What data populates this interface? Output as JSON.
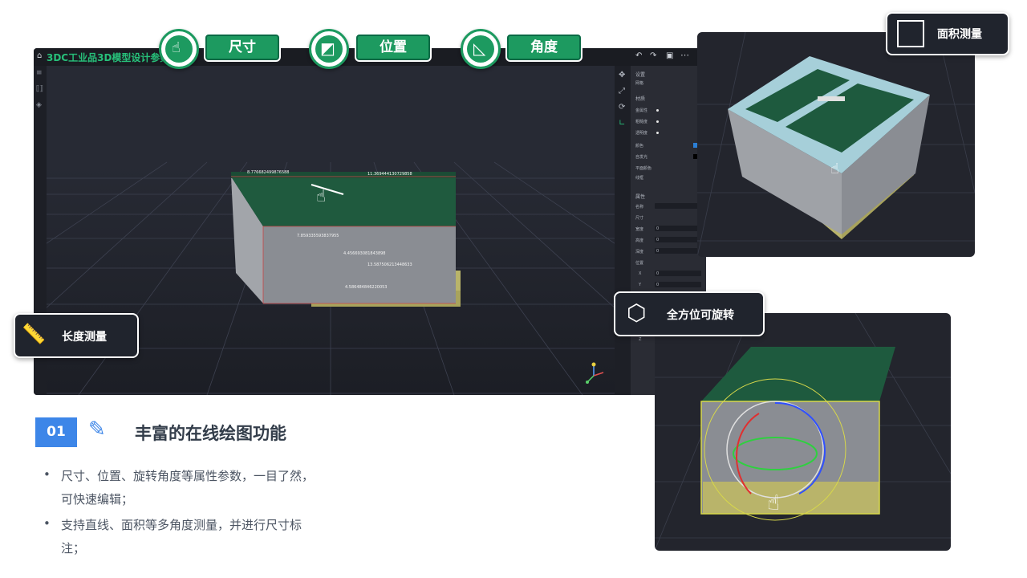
{
  "editor": {
    "title": "3DC工业品3D模型设计参数",
    "measurements": [
      "8.776682499876588",
      "11.369444130729858",
      "7.859335593837955",
      "4.456693081843898",
      "13.587506213448633",
      "4.586484846220053"
    ],
    "panel": {
      "section_settings": "设置",
      "settings_sub": "网格",
      "section_material": "材质",
      "rows_material": [
        "金属性",
        "粗糙度",
        "透明度",
        "颜色",
        "自发光",
        "平面颜色",
        "线框"
      ],
      "section_props": "属性",
      "rows_props": [
        "名称",
        "尺寸",
        "宽度",
        "高度",
        "深度",
        "位置",
        "X",
        "Y",
        "Z"
      ],
      "zero": "0"
    }
  },
  "tools": {
    "size_label": "尺寸",
    "position_label": "位置",
    "angle_label": "角度"
  },
  "badges": {
    "area": "面积测量",
    "length": "长度测量",
    "rotate": "全方位可旋转"
  },
  "section": {
    "number": "01",
    "title": "丰富的在线绘图功能",
    "bullets": [
      [
        "尺寸、位置、旋转角度等属性参数，一目了然，",
        "可快速编辑；"
      ],
      [
        "支持直线、面积等多角度测量，并进行尺寸标",
        "注；"
      ]
    ]
  },
  "colors": {
    "accent_green": "#1d9a60",
    "accent_blue": "#3d86e8",
    "badge_dark": "#20242d",
    "app_title_green": "#27c07a"
  },
  "icons": [
    "home-icon",
    "hand-cursor-icon",
    "move-icon",
    "rotate-icon",
    "angle-icon",
    "area-icon",
    "ruler-icon",
    "cube-rotate-icon",
    "pencil-ruler-icon"
  ]
}
